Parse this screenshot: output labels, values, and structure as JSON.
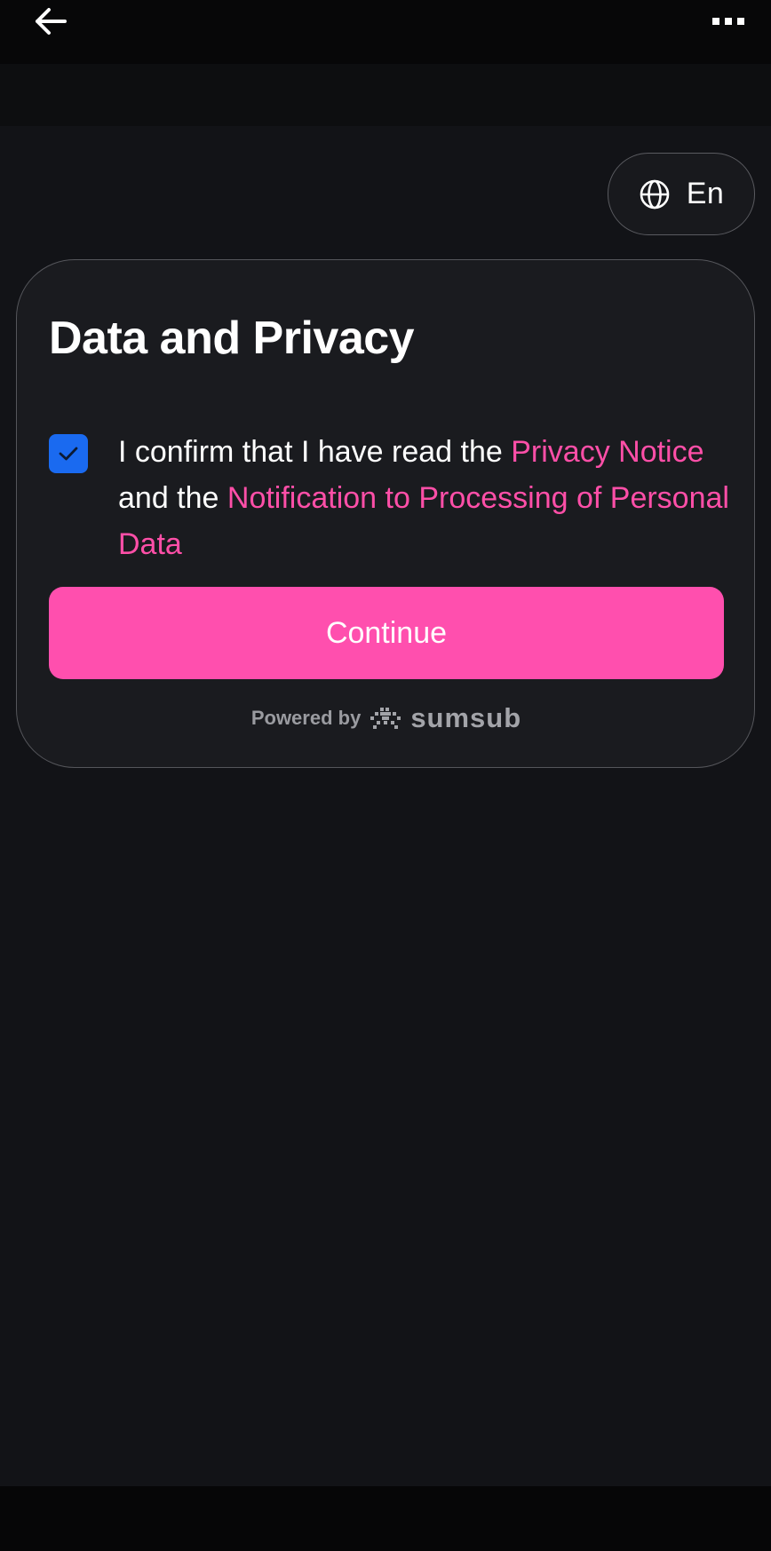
{
  "top_bar": {
    "back_icon": "arrow-left-icon",
    "more_icon": "more-horizontal-icon"
  },
  "language": {
    "icon": "globe-icon",
    "label": "En"
  },
  "card": {
    "title": "Data and Privacy",
    "checkbox_checked": true,
    "consent": {
      "prefix": "I confirm that I have read the ",
      "privacy_link": "Privacy Notice",
      "middle": " and the ",
      "processing_link": "Notification to Processing of Personal Data"
    },
    "continue_label": "Continue",
    "powered_by": "Powered by",
    "brand": "sumsub"
  },
  "colors": {
    "accent": "#ff4fae",
    "link": "#ff4fa8",
    "checkbox": "#1a6af0",
    "background": "#121317"
  }
}
